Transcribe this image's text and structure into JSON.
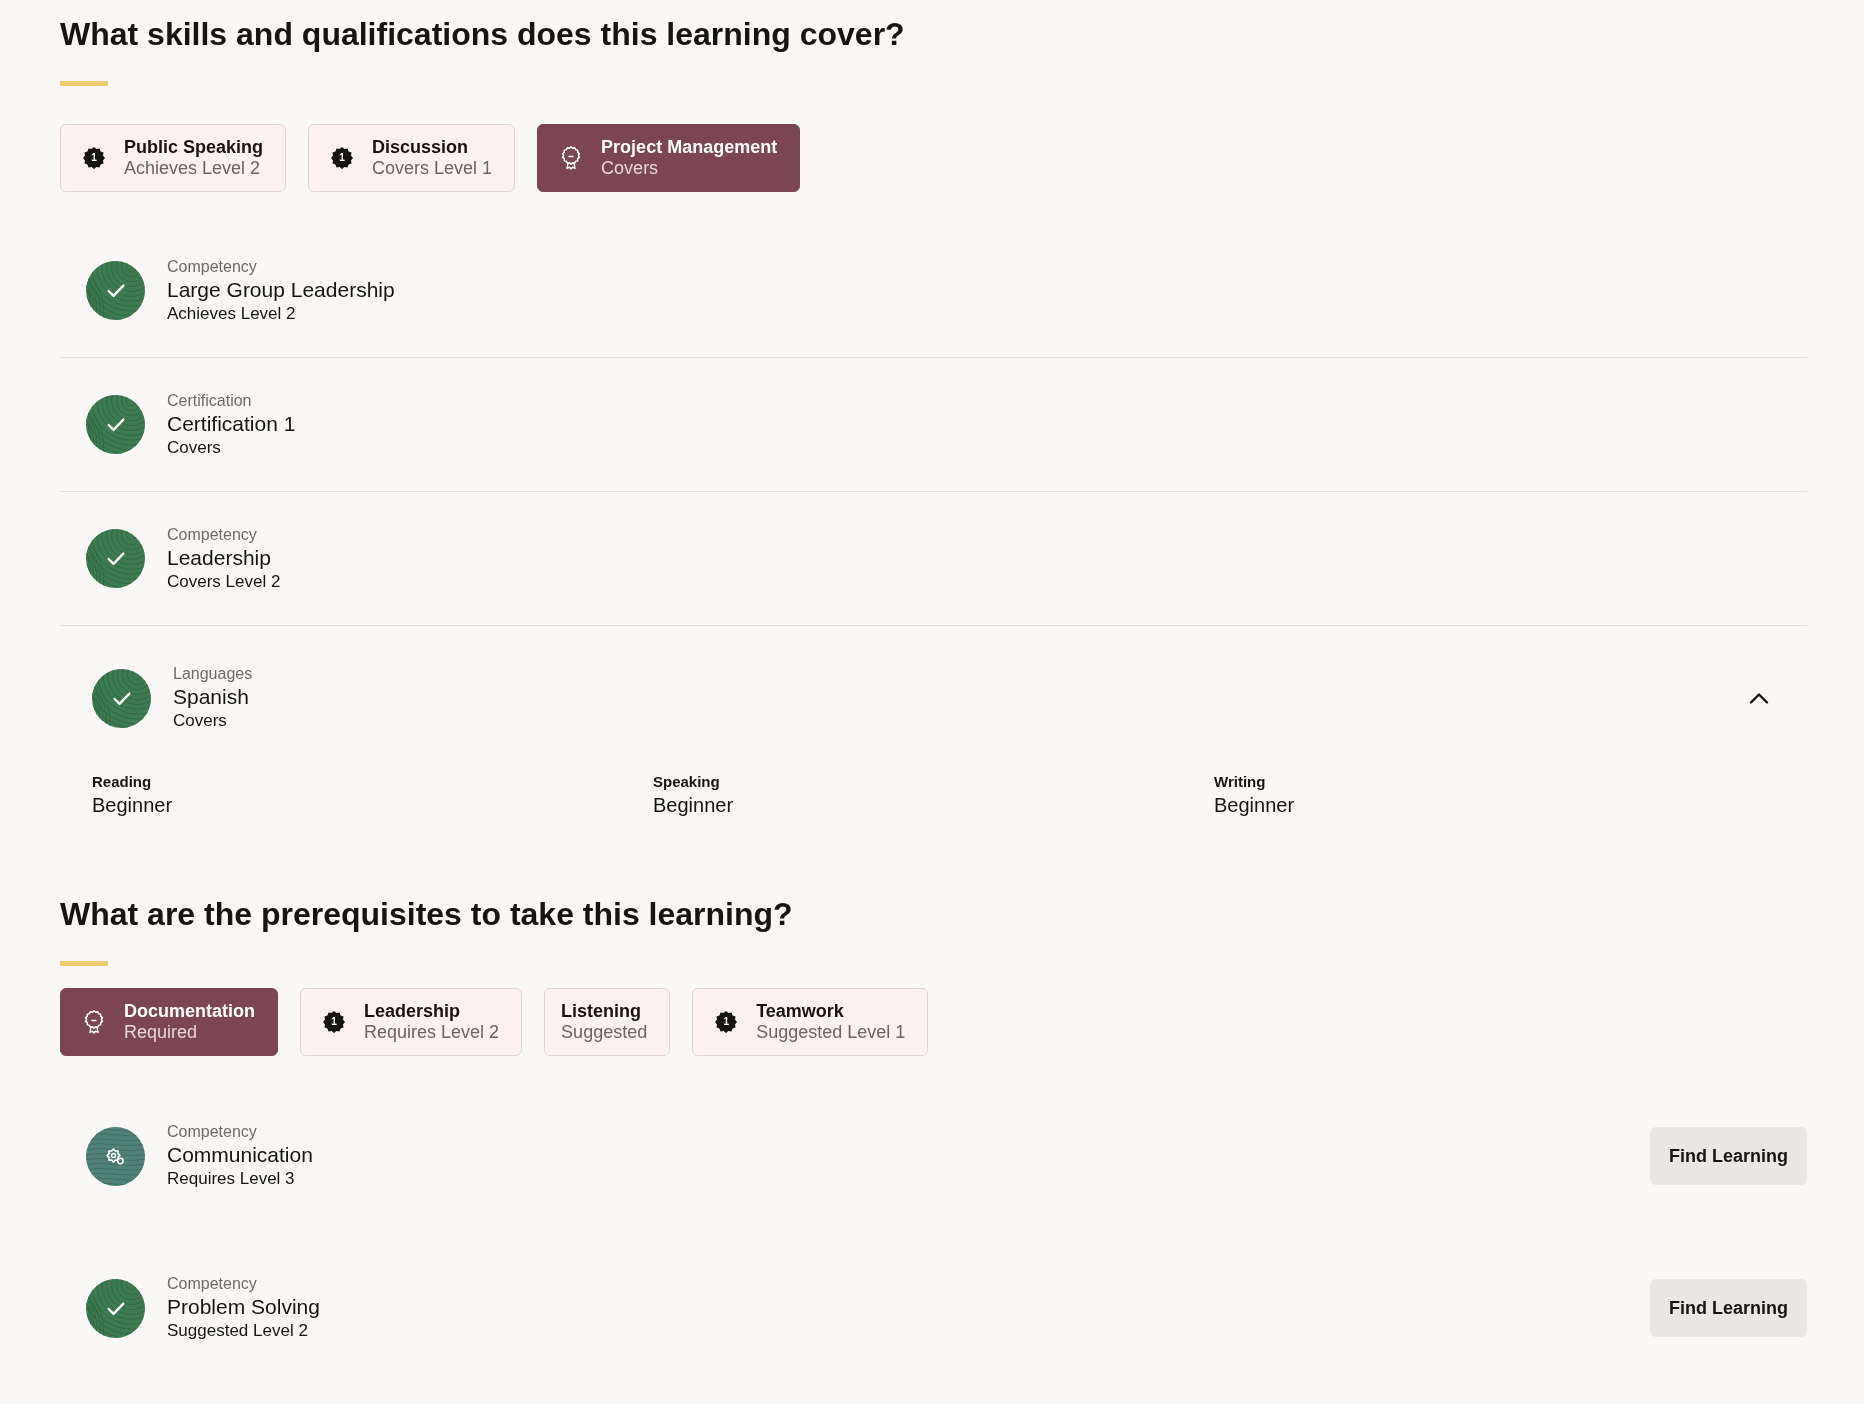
{
  "sections": [
    {
      "heading": "What skills and qualifications does this learning cover?",
      "dividers": true,
      "filters": [
        {
          "kind": "level",
          "badge": "1",
          "title": "Public Speaking",
          "subtitle": "Achieves Level 2",
          "selected": false
        },
        {
          "kind": "level",
          "badge": "1",
          "title": "Discussion",
          "subtitle": "Covers Level 1",
          "selected": false
        },
        {
          "kind": "award",
          "title": "Project Management",
          "subtitle": "Covers",
          "selected": true
        }
      ],
      "items": [
        {
          "category": "Competency",
          "title": "Large Group Leadership",
          "subtitle": "Achieves Level 2",
          "completed": true
        },
        {
          "category": "Certification",
          "title": "Certification 1",
          "subtitle": "Covers",
          "completed": true
        },
        {
          "category": "Competency",
          "title": "Leadership",
          "subtitle": "Covers Level 2",
          "completed": true
        },
        {
          "category": "Languages",
          "title": "Spanish",
          "subtitle": "Covers",
          "completed": true,
          "expanded": true,
          "details": [
            {
              "label": "Reading",
              "value": "Beginner"
            },
            {
              "label": "Speaking",
              "value": "Beginner"
            },
            {
              "label": "Writing",
              "value": "Beginner"
            }
          ]
        }
      ]
    },
    {
      "heading": "What are the prerequisites to take this learning?",
      "filters": [
        {
          "kind": "award",
          "title": "Documentation",
          "subtitle": "Required",
          "selected": true
        },
        {
          "kind": "level",
          "badge": "1",
          "title": "Leadership",
          "subtitle": "Requires Level 2",
          "selected": false
        },
        {
          "kind": "plain",
          "title": "Listening",
          "subtitle": "Suggested",
          "selected": false
        },
        {
          "kind": "level",
          "badge": "1",
          "title": "Teamwork",
          "subtitle": "Suggested Level 1",
          "selected": false
        }
      ],
      "items": [
        {
          "category": "Competency",
          "title": "Communication",
          "subtitle": "Requires Level 3",
          "completed": false,
          "action": "Find Learning"
        },
        {
          "category": "Competency",
          "title": "Problem Solving",
          "subtitle": "Suggested Level 2",
          "completed": true,
          "action": "Find Learning"
        }
      ]
    }
  ]
}
